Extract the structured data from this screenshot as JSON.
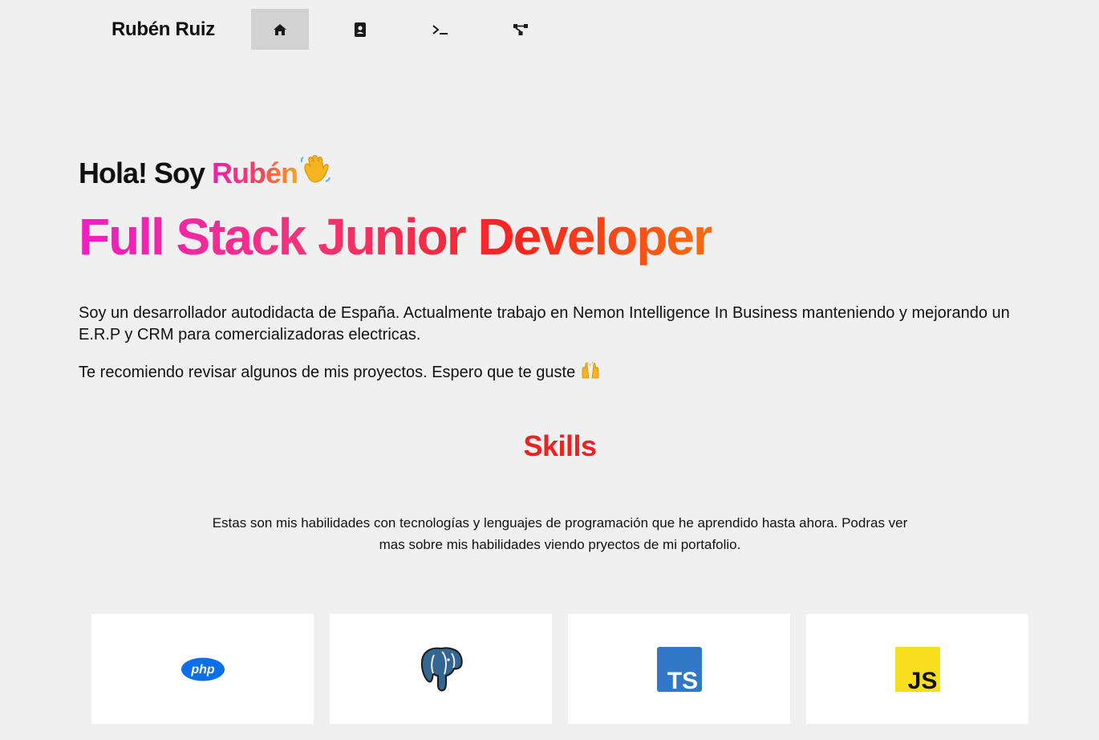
{
  "nav": {
    "brand": "Rubén Ruiz",
    "items": [
      {
        "icon": "home-icon",
        "active": true
      },
      {
        "icon": "contact-card-icon",
        "active": false
      },
      {
        "icon": "terminal-icon",
        "active": false
      },
      {
        "icon": "network-graph-icon",
        "active": false
      }
    ]
  },
  "hero": {
    "greeting": "Hola! Soy ",
    "name": "Rubén",
    "wave_emoji": "waving-hand-icon",
    "role": "Full Stack Junior Developer",
    "intro": "Soy un desarrollador autodidacta de España. Actualmente trabajo en Nemon Intelligence In Business manteniendo y mejorando un E.R.P y CRM para comercializadoras electricas.",
    "recommend": "Te recomiendo revisar algunos de mis proyectos. Espero que te guste",
    "recommend_emoji": "raising-hands-icon"
  },
  "skills": {
    "title": "Skills",
    "description": "Estas son mis habilidades con tecnologías y lenguajes de programación que he aprendido hasta ahora. Podras ver mas sobre mis habilidades viendo pryectos de mi portafolio.",
    "items": [
      {
        "icon": "php-icon",
        "logo_text": "php",
        "color": "#0a6fe8"
      },
      {
        "icon": "postgresql-icon",
        "color": "#336791"
      },
      {
        "icon": "typescript-icon",
        "logo_text": "TS",
        "color": "#3178c6"
      },
      {
        "icon": "javascript-icon",
        "logo_text": "JS",
        "color": "#f7df1e"
      }
    ]
  },
  "colors": {
    "background": "#f0f0f0",
    "nav_active": "#d2d2d2",
    "skills_title": "#ee2222",
    "card": "#ffffff"
  }
}
